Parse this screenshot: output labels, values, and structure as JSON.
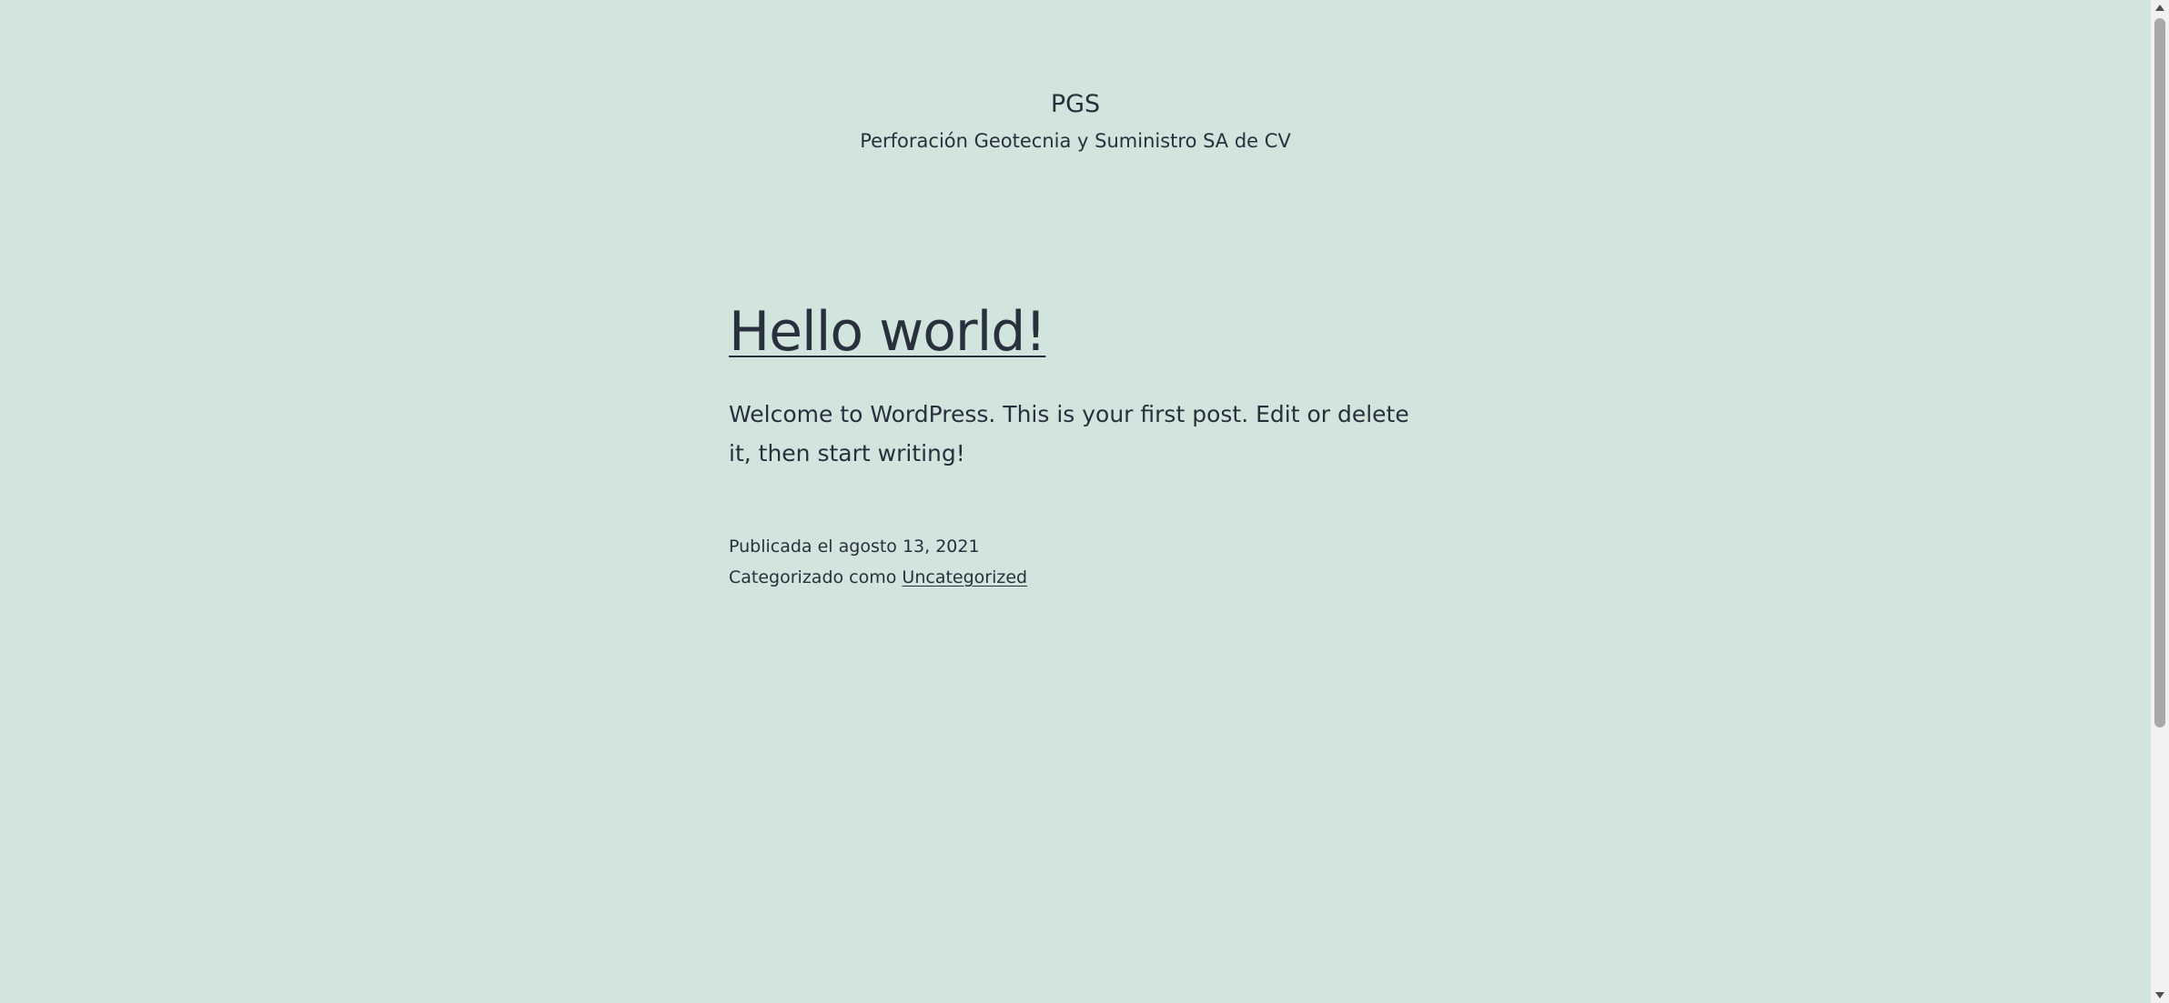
{
  "header": {
    "site_title": "PGS",
    "site_description": "Perforación Geotecnia y Suministro SA de CV"
  },
  "post": {
    "title": "Hello world!",
    "content": "Welcome to WordPress. This is your first post. Edit or delete it, then start writing!",
    "published_prefix": "Publicada el ",
    "published_date": "agosto 13, 2021",
    "category_prefix": "Categorizado como ",
    "category": "Uncategorized"
  },
  "colors": {
    "background": "#d1e4dd",
    "text": "#28303d",
    "scrollbar_thumb": "#a8a8a8"
  },
  "icons": {
    "scroll_up": "triangle-up-icon",
    "scroll_down": "triangle-down-icon"
  }
}
